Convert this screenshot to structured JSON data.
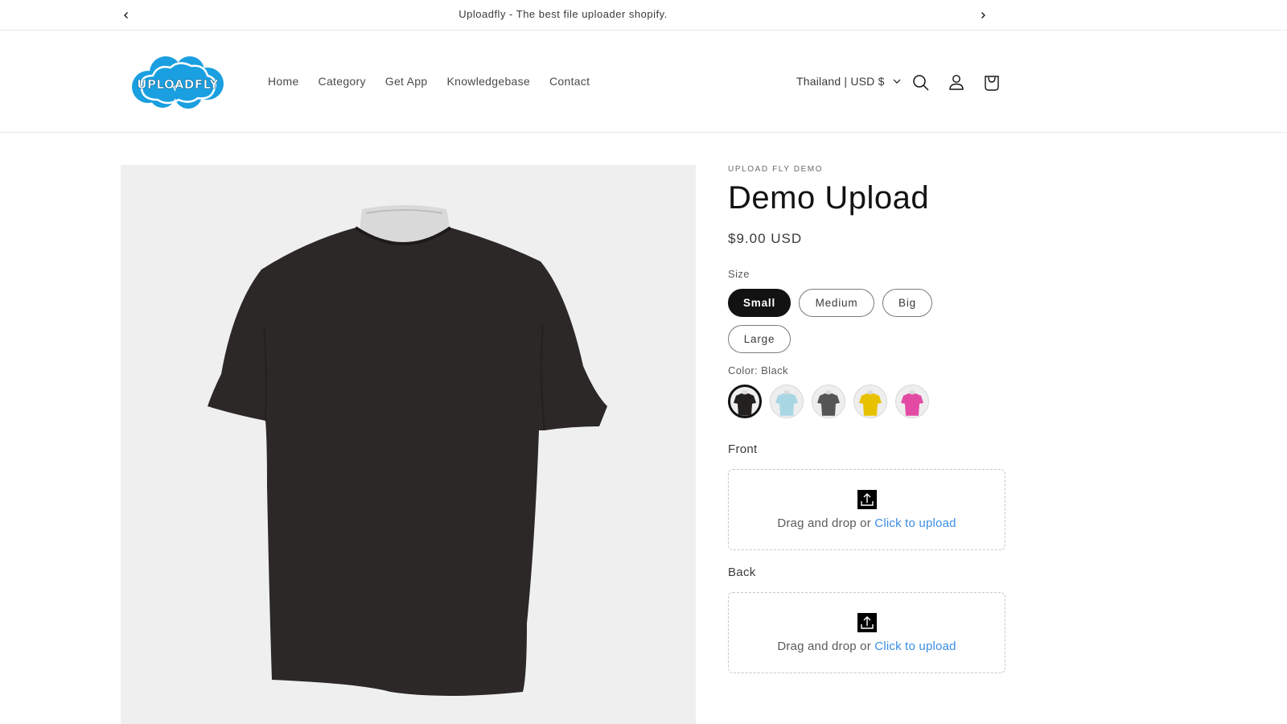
{
  "announcement": {
    "message": "Uploadfly - The best file uploader shopify.",
    "prev_icon": "chevron-left-icon",
    "next_icon": "chevron-right-icon"
  },
  "header": {
    "logo_text": "UPLOADFLY",
    "brand_color": "#1a9fe0",
    "nav": [
      {
        "label": "Home"
      },
      {
        "label": "Category"
      },
      {
        "label": "Get App"
      },
      {
        "label": "Knowledgebase"
      },
      {
        "label": "Contact"
      }
    ],
    "locale": "Thailand | USD $",
    "icons": [
      "search-icon",
      "account-icon",
      "cart-icon"
    ]
  },
  "product": {
    "vendor": "UPLOAD FLY DEMO",
    "title": "Demo Upload",
    "price": "$9.00 USD",
    "image_color": "#2b2827",
    "size": {
      "label": "Size",
      "selected": "Small",
      "options": [
        "Small",
        "Medium",
        "Big",
        "Large"
      ]
    },
    "color": {
      "label": "Color: Black",
      "selected": "Black",
      "options": [
        {
          "name": "Black",
          "hex": "#232020"
        },
        {
          "name": "Light Blue",
          "hex": "#a9d6e3"
        },
        {
          "name": "Gray",
          "hex": "#555555"
        },
        {
          "name": "Yellow",
          "hex": "#e8c200"
        },
        {
          "name": "Pink",
          "hex": "#e24aa4"
        }
      ]
    },
    "uploads": [
      {
        "label": "Front",
        "text": "Drag and drop or ",
        "link": "Click to upload"
      },
      {
        "label": "Back",
        "text": "Drag and drop or ",
        "link": "Click to upload"
      }
    ]
  }
}
